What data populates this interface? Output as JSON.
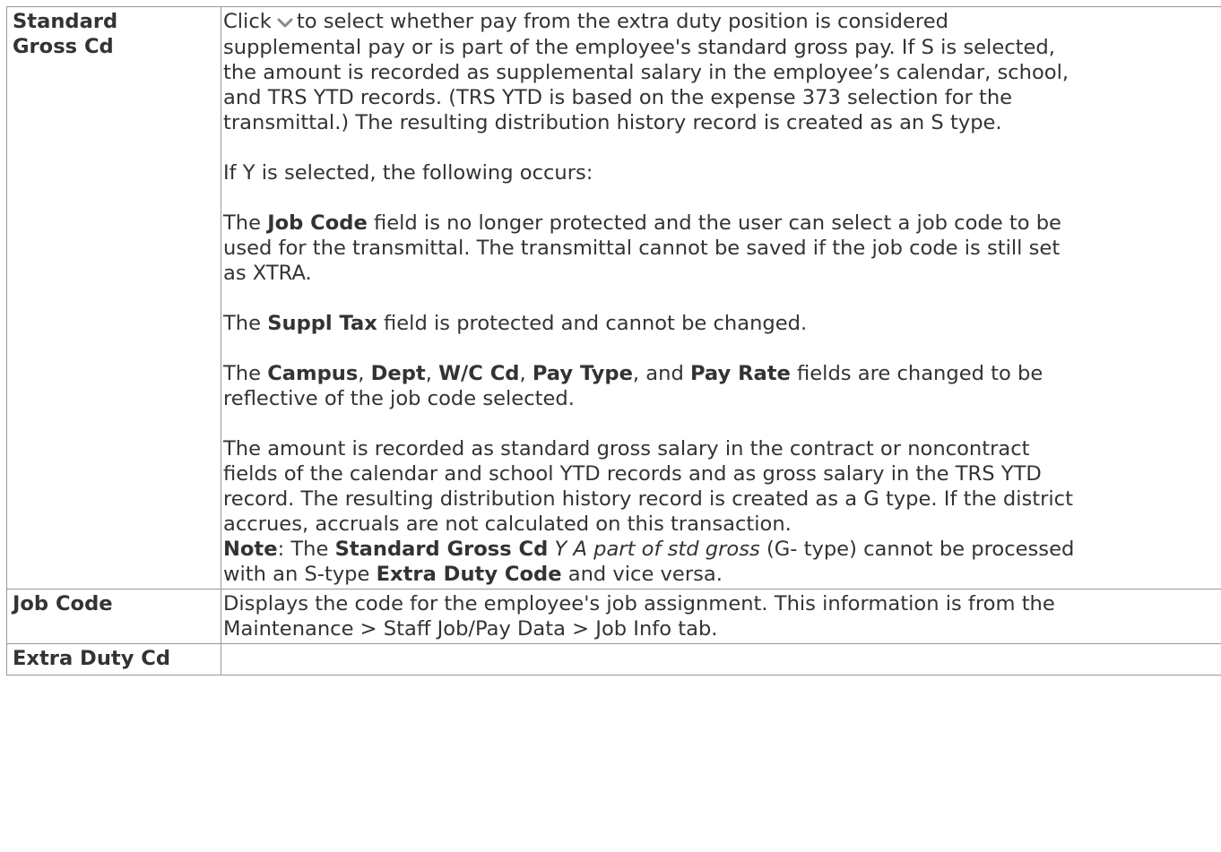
{
  "rows": {
    "standard_gross": {
      "label_line1": "Standard",
      "label_line2": "Gross Cd",
      "p1_click": "Click",
      "p1_line1_rest": "to select whether pay from the extra duty position is considered",
      "p1_line2": "supplemental pay or is part of the employee's standard gross pay. If S is selected,",
      "p1_line3": "the amount is recorded as supplemental salary in the employee’s calendar, school,",
      "p1_line4": "and TRS YTD records. (TRS YTD is based on the expense 373 selection for the",
      "p1_line5": "transmittal.) The resulting distribution history record is created as an S type.",
      "p2": "If Y is selected, the following occurs:",
      "p3_the": "The",
      "p3_job_code": "Job Code",
      "p3_line1_rest": "field is no longer protected and the user can select a job code to be",
      "p3_line2": "used for the transmittal. The transmittal cannot be saved if the job code is still set",
      "p3_line3": "as XTRA.",
      "p4_the": "The",
      "p4_suppl_tax": "Suppl Tax",
      "p4_rest": "field is protected and cannot be changed.",
      "p5_the": "The",
      "p5_campus": "Campus",
      "p5_comma1": ",",
      "p5_dept": "Dept",
      "p5_comma2": ",",
      "p5_wc": "W/C Cd",
      "p5_comma3": ",",
      "p5_pay_type": "Pay Type",
      "p5_and": ", and",
      "p5_pay_rate": "Pay Rate",
      "p5_line1_rest": "fields are changed to be",
      "p5_line2": "reflective of the job code selected.",
      "p6_line1": "The amount is recorded as standard gross salary in the contract or noncontract",
      "p6_line2": "fields of the calendar and school YTD records and as gross salary in the TRS YTD",
      "p6_line3": "record. The resulting distribution history record is created as a G type. If the district",
      "p6_line4": "accrues, accruals are not calculated on this transaction.",
      "note_label": "Note",
      "note_colon": ": The",
      "note_std_gross": "Standard Gross Cd",
      "note_italic": "Y A part of std gross",
      "note_line1_rest": "(G- type) cannot be processed",
      "note_with": "with an S-type",
      "note_extra_duty": "Extra Duty Code",
      "note_end": "and vice versa."
    },
    "job_code": {
      "label": "Job Code",
      "line1": "Displays the code for the employee's job assignment. This information is from the",
      "line2": "Maintenance > Staff Job/Pay Data > Job Info tab."
    },
    "extra_duty": {
      "label": "Extra Duty Cd",
      "desc": ""
    }
  },
  "icons": {
    "dropdown": "chevron-down-icon"
  },
  "colors": {
    "text": "#333333",
    "border": "#999999",
    "chevron": "#8a8a8a"
  }
}
